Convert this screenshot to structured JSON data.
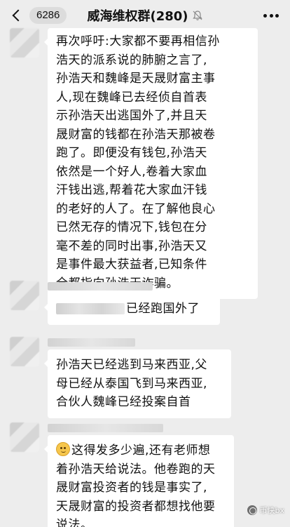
{
  "header": {
    "unread_count": "6286",
    "title": "威海维权群(280)"
  },
  "messages": [
    {
      "text_lines": [
        "再次呼吁:大家都不要再相信孙",
        "浩天的派系说的肺腑之言了,",
        "孙浩天和魏峰是天晟财富主事",
        "人,现在魏峰已去经侦自首表",
        "示孙浩天出逃国外了,并且天",
        "晟财富的钱都在孙浩天那被卷",
        "跑了。即便没有钱包,孙浩天",
        "依然是一个好人,卷着大家血",
        "汗钱出逃,帮着花大家血汗钱",
        "的老好的人了。在了解他良心",
        "已然无存的情况下,钱包在分",
        "毫不差的同时出事,孙浩天又",
        "是事件最大获益者,已知条件",
        "全都指向孙浩天诈骗。"
      ]
    },
    {
      "text": "已经跑国外了"
    },
    {
      "text_lines": [
        "孙浩天已经逃到马来西亚,父",
        "母已经从泰国飞到马来西亚,",
        "合伙人魏峰已经投案自首"
      ]
    },
    {
      "emoji": "cold-sweat-face",
      "text_lines": [
        "这得发多少遍,还有老师想",
        "着孙浩天给说法。他卷跑的天",
        "晟财富投资者的钱是事实了,",
        "天晟财富的投资者都想找他要",
        "说法。"
      ]
    }
  ],
  "watermark": {
    "text": "币快bx"
  },
  "colors": {
    "chat_background": "#ededed",
    "bubble": "#ffffff",
    "badge": "#dcdcdc"
  }
}
